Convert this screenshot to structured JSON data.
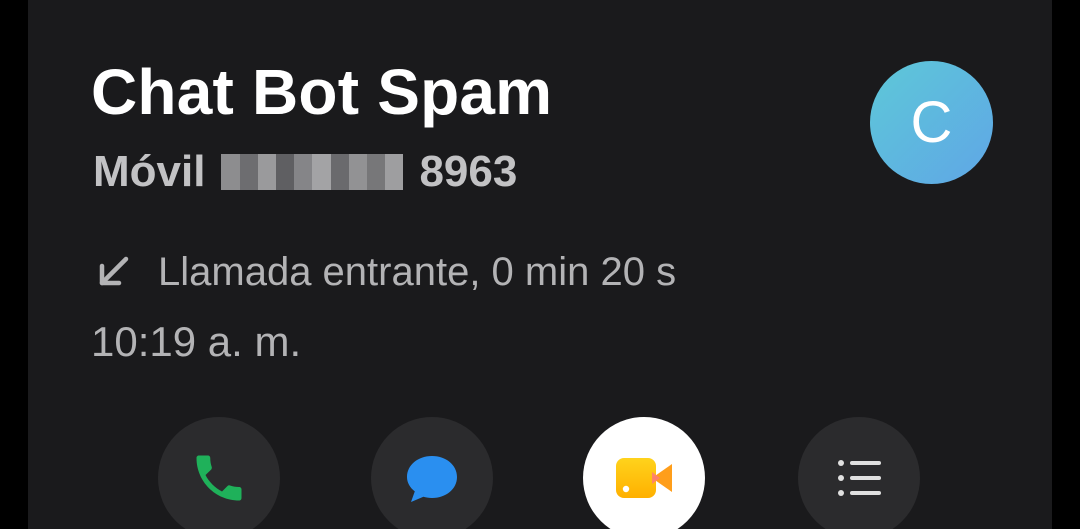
{
  "contact": {
    "name": "Chat Bot Spam",
    "number_type": "Móvil",
    "number_visible_suffix": "8963",
    "avatar_initial": "C"
  },
  "call": {
    "direction_icon": "incoming-arrow-icon",
    "description": "Llamada entrante, 0 min 20 s",
    "time": "10:19 a. m."
  },
  "actions": [
    {
      "name": "call",
      "icon": "phone-icon",
      "color": "#1fb15a"
    },
    {
      "name": "message",
      "icon": "chat-bubble-icon",
      "color": "#2a8ff0"
    },
    {
      "name": "video",
      "icon": "video-camera-icon",
      "color": "#ffc21a"
    },
    {
      "name": "details",
      "icon": "list-icon",
      "color": "#e0e0e0"
    }
  ]
}
